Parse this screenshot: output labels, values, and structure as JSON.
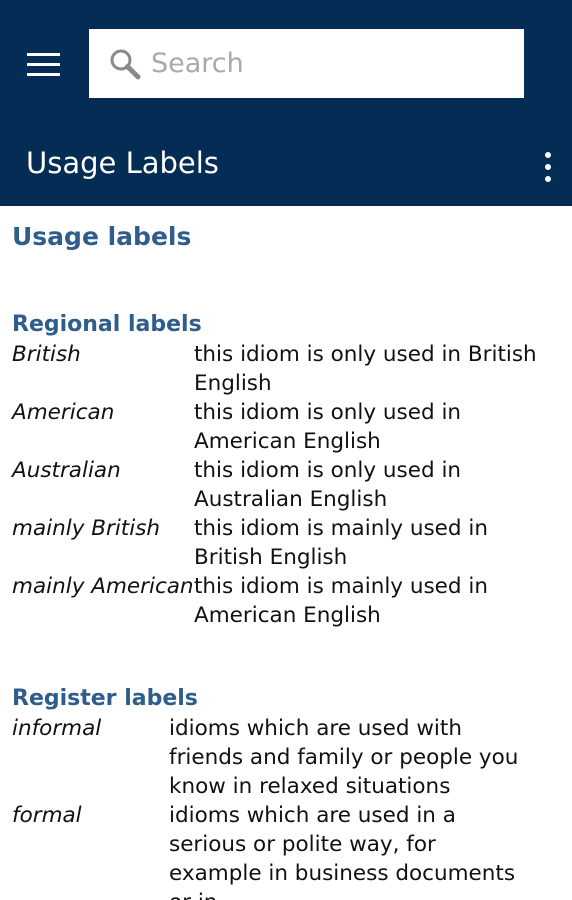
{
  "header": {
    "search_placeholder": "Search",
    "title": "Usage Labels"
  },
  "page": {
    "heading": "Usage labels"
  },
  "regional": {
    "heading": "Regional labels",
    "rows": [
      {
        "term": "British",
        "description": "this idiom is only used in British English"
      },
      {
        "term": "American",
        "description": "this idiom is only used in American English"
      },
      {
        "term": "Australian",
        "description": "this idiom is only used in Australian English"
      },
      {
        "term": "mainly British",
        "description": "this idiom is mainly used in British English"
      },
      {
        "term": "mainly American",
        "description": "this idiom is mainly used in American English"
      }
    ]
  },
  "register": {
    "heading": "Register labels",
    "rows": [
      {
        "term": "informal",
        "description": "idioms which are used with friends and family or people you know in relaxed situations"
      },
      {
        "term": "formal",
        "description": "idioms which are used in a serious or polite way, for example in business documents or in"
      }
    ]
  },
  "colors": {
    "app_bar": "#042c54",
    "heading": "#2f5d8c",
    "body_text": "#111111"
  },
  "icons": {
    "menu": "hamburger-menu-icon",
    "search": "magnifier-search-icon",
    "overflow": "vertical-ellipsis-icon"
  }
}
